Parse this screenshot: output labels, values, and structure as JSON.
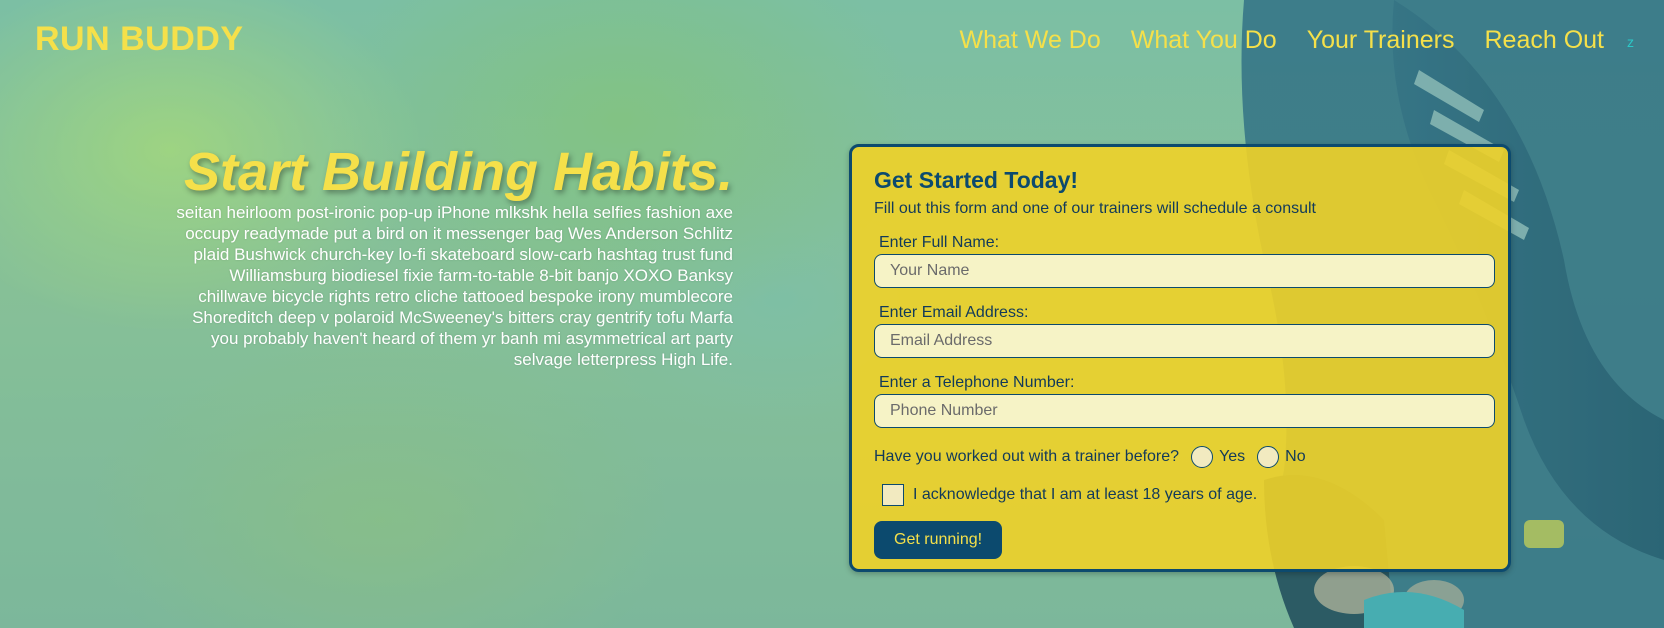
{
  "header": {
    "logo": "RUN BUDDY",
    "nav": [
      "What We Do",
      "What You Do",
      "Your Trainers",
      "Reach Out"
    ],
    "nav_extra": "z"
  },
  "intro": {
    "title": "Start Building Habits.",
    "body": "seitan heirloom post-ironic pop-up iPhone mlkshk hella selfies fashion axe occupy readymade put a bird on it messenger bag Wes Anderson Schlitz plaid Bushwick church-key lo-fi skateboard slow-carb hashtag trust fund Williamsburg biodiesel fixie farm-to-table 8-bit banjo XOXO Banksy chillwave bicycle rights retro cliche tattooed bespoke irony mumblecore Shoreditch deep v polaroid McSweeney's bitters cray gentrify tofu Marfa you probably haven't heard of them yr banh mi asymmetrical art party selvage letterpress High Life."
  },
  "form": {
    "title": "Get Started Today!",
    "subtitle": "Fill out this form and one of our trainers will schedule a consult",
    "name_label": "Enter Full Name:",
    "name_placeholder": "Your Name",
    "email_label": "Enter Email Address:",
    "email_placeholder": "Email Address",
    "phone_label": "Enter a Telephone Number:",
    "phone_placeholder": "Phone Number",
    "question": "Have you worked out with a trainer before?",
    "yes": "Yes",
    "no": "No",
    "acknowledge": "I acknowledge that I am at least 18 years of age.",
    "submit": "Get running!"
  },
  "colors": {
    "accent_yellow": "#f5e04a",
    "navy": "#0c4a6e",
    "card": "#f0d228"
  }
}
